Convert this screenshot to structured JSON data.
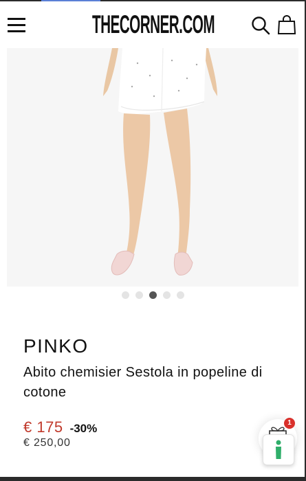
{
  "header": {
    "logo_text": "THECORNER.COM",
    "menu_icon": "hamburger-menu-icon",
    "search_icon": "search-icon",
    "bag_icon": "shopping-bag-icon"
  },
  "gallery": {
    "image_subject": "product-photo",
    "slide_count": 5,
    "active_slide": 3
  },
  "product": {
    "brand": "PINKO",
    "name": "Abito chemisier Sestola in popeline di cotone",
    "price_current": "€ 175",
    "discount": "-30%",
    "price_original": "€ 250,00"
  },
  "gift_widget": {
    "icon": "gift-icon",
    "badge_count": "1"
  },
  "colors": {
    "sale_price": "#c0392b",
    "badge": "#d9302b",
    "gift_green": "#2fae6a",
    "dot_active": "#555555",
    "dot_inactive": "#e4e4e4"
  }
}
